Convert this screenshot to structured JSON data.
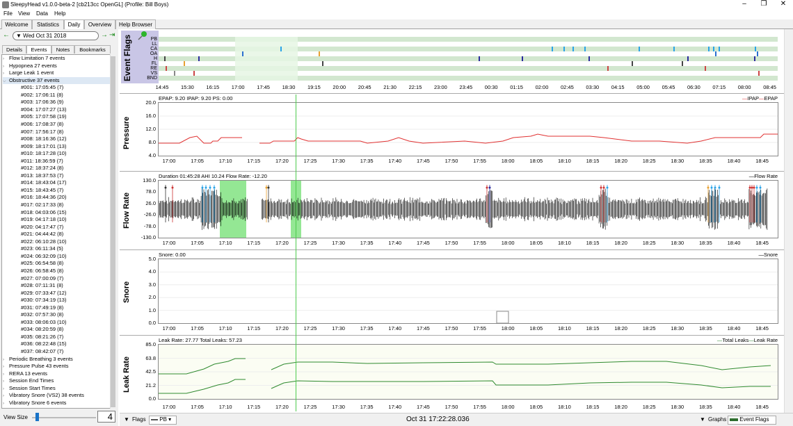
{
  "window": {
    "title": "SleepyHead v1.0.0-beta-2 [cb213cc OpenGL] (Profile: Bill Boys)"
  },
  "menu": [
    "File",
    "View",
    "Data",
    "Help"
  ],
  "tabs": [
    "Welcome",
    "Statistics",
    "Daily",
    "Overview",
    "Help Browser"
  ],
  "active_tab": "Daily",
  "date": {
    "value": "Wed Oct 31 2018"
  },
  "subtabs": [
    "Details",
    "Events",
    "Notes",
    "Bookmarks"
  ],
  "active_subtab": "Events",
  "event_list": [
    {
      "label": "Flow Limitation 7 events",
      "level": 0,
      "expanded": false
    },
    {
      "label": "Hypopnea 27 events",
      "level": 0,
      "expanded": false
    },
    {
      "label": "Large Leak 1 event",
      "level": 0,
      "expanded": false
    },
    {
      "label": "Obstructive 37 events",
      "level": 0,
      "expanded": true,
      "selected": true
    },
    {
      "label": "#001: 17:05:45 (7)",
      "level": 1
    },
    {
      "label": "#002: 17:06:11 (8)",
      "level": 1
    },
    {
      "label": "#003: 17:06:36 (9)",
      "level": 1
    },
    {
      "label": "#004: 17:07:27 (13)",
      "level": 1
    },
    {
      "label": "#005: 17:07:58 (19)",
      "level": 1
    },
    {
      "label": "#006: 17:08:37 (8)",
      "level": 1
    },
    {
      "label": "#007: 17:56:17 (8)",
      "level": 1
    },
    {
      "label": "#008: 18:16:36 (12)",
      "level": 1
    },
    {
      "label": "#009: 18:17:01 (13)",
      "level": 1
    },
    {
      "label": "#010: 18:17:28 (10)",
      "level": 1
    },
    {
      "label": "#011: 18:36:59 (7)",
      "level": 1
    },
    {
      "label": "#012: 18:37:24 (8)",
      "level": 1
    },
    {
      "label": "#013: 18:37:53 (7)",
      "level": 1
    },
    {
      "label": "#014: 18:43:04 (17)",
      "level": 1
    },
    {
      "label": "#015: 18:43:45 (7)",
      "level": 1
    },
    {
      "label": "#016: 18:44:36 (20)",
      "level": 1
    },
    {
      "label": "#017: 02:17:33 (8)",
      "level": 1
    },
    {
      "label": "#018: 04:03:06 (15)",
      "level": 1
    },
    {
      "label": "#019: 04:17:18 (10)",
      "level": 1
    },
    {
      "label": "#020: 04:17:47 (7)",
      "level": 1
    },
    {
      "label": "#021: 04:44:42 (8)",
      "level": 1
    },
    {
      "label": "#022: 06:10:28 (10)",
      "level": 1
    },
    {
      "label": "#023: 06:11:34 (5)",
      "level": 1
    },
    {
      "label": "#024: 06:32:09 (10)",
      "level": 1
    },
    {
      "label": "#025: 06:54:58 (8)",
      "level": 1
    },
    {
      "label": "#026: 06:58:45 (8)",
      "level": 1
    },
    {
      "label": "#027: 07:00:09 (7)",
      "level": 1
    },
    {
      "label": "#028: 07:11:31 (8)",
      "level": 1
    },
    {
      "label": "#029: 07:33:47 (12)",
      "level": 1
    },
    {
      "label": "#030: 07:34:19 (13)",
      "level": 1
    },
    {
      "label": "#031: 07:49:19 (8)",
      "level": 1
    },
    {
      "label": "#032: 07:57:30 (8)",
      "level": 1
    },
    {
      "label": "#033: 08:06:03 (10)",
      "level": 1
    },
    {
      "label": "#034: 08:20:59 (8)",
      "level": 1
    },
    {
      "label": "#035: 08:21:26 (7)",
      "level": 1
    },
    {
      "label": "#036: 08:22:48 (15)",
      "level": 1
    },
    {
      "label": "#037: 08:42:07 (7)",
      "level": 1
    },
    {
      "label": "Periodic Breathing 3 events",
      "level": 0,
      "expanded": false
    },
    {
      "label": "Pressure Pulse 43 events",
      "level": 0,
      "expanded": false
    },
    {
      "label": "RERA 13 events",
      "level": 0,
      "expanded": false
    },
    {
      "label": "Session End Times",
      "level": 0,
      "expanded": false
    },
    {
      "label": "Session Start Times",
      "level": 0,
      "expanded": false
    },
    {
      "label": "Vibratory Snore (VS2)  38 events",
      "level": 0,
      "expanded": false
    },
    {
      "label": "Vibratory Snore 6 events",
      "level": 0,
      "expanded": false
    }
  ],
  "view_size": {
    "label": "View Size",
    "value": "4",
    "level": 0.05
  },
  "event_flags": {
    "title": "Event Flags",
    "rows": [
      "PB",
      "LL",
      "CA",
      "OA",
      "H",
      "FL",
      "RE",
      "VS",
      "BND"
    ],
    "time_ticks": [
      "14:45",
      "15:30",
      "16:15",
      "17:00",
      "17:45",
      "18:30",
      "19:15",
      "20:00",
      "20:45",
      "21:30",
      "22:15",
      "23:00",
      "23:45",
      "00:30",
      "01:15",
      "02:00",
      "02:45",
      "03:30",
      "04:15",
      "05:00",
      "05:45",
      "06:30",
      "07:15",
      "08:00",
      "08:45"
    ],
    "colors": {
      "row_bg": "#d2e7cf",
      "row_alt": "#ffffff",
      "selection": "#e6f6e4",
      "band": "#c9c6e6"
    }
  },
  "time_axis": [
    "17:00",
    "17:05",
    "17:10",
    "17:15",
    "17:20",
    "17:25",
    "17:30",
    "17:35",
    "17:40",
    "17:45",
    "17:50",
    "17:55",
    "18:00",
    "18:05",
    "18:10",
    "18:15",
    "18:20",
    "18:25",
    "18:30",
    "18:35",
    "18:40",
    "18:45"
  ],
  "pressure": {
    "title": "Pressure",
    "info": "EPAP: 9.20 IPAP: 9.20 PS: 0.00",
    "legend": "IPAP",
    "legend2": "EPAP",
    "color": "#e03030",
    "y_ticks": [
      "20.0",
      "16.0",
      "12.0",
      "8.0",
      "4.0"
    ]
  },
  "flow": {
    "title": "Flow Rate",
    "info": "Duration 01:45:28 AHI 10.24 Flow Rate: -12.20",
    "legend": "Flow Rate",
    "y_ticks": [
      "130.0",
      "78.0",
      "26.0",
      "-26.0",
      "-78.0",
      "-130.0"
    ],
    "highlight_color": "#66dd66"
  },
  "snore": {
    "title": "Snore",
    "info": "Snore: 0.00",
    "legend": "Snore",
    "y_ticks": [
      "5.0",
      "4.0",
      "3.0",
      "2.0",
      "1.0",
      "0.0"
    ]
  },
  "leak": {
    "title": "Leak Rate",
    "info": "Leak Rate: 27.77 Total Leaks: 57.23",
    "legend": "Total Leaks",
    "legend2": "Leak Rate",
    "color": "#2f8a2f",
    "y_ticks": [
      "85.0",
      "63.8",
      "42.5",
      "21.2",
      "0.0"
    ]
  },
  "statusbar": {
    "flags_label": "Flags",
    "pb_label": "PB",
    "timestamp": "Oct 31 17:22:28.036",
    "graphs_label": "Graphs",
    "event_flags_label": "Event Flags"
  }
}
